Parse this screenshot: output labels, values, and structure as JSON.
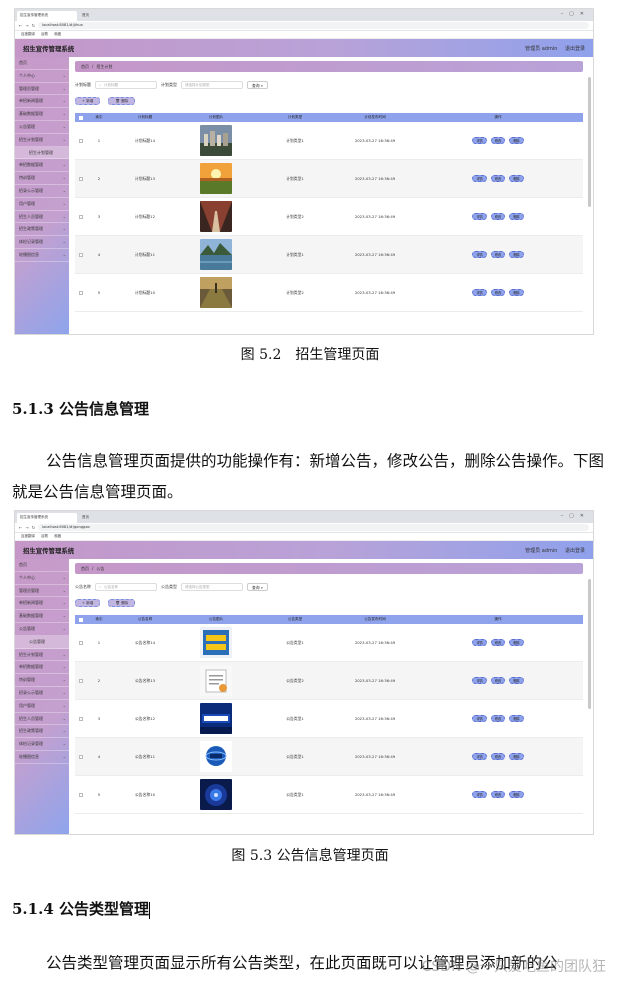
{
  "figures": [
    {
      "tabs": [
        "招生宣传管理系统",
        "首页"
      ],
      "url": "localhost:8081/#/jihua",
      "bookmarks": [
        "百度翻译",
        "谷歌",
        "收藏"
      ],
      "app_title": "招生宣传管理系统",
      "user_info": "管理员 admin",
      "logout": "退出登录",
      "menu": [
        {
          "label": "首页",
          "chev": false,
          "sub": false
        },
        {
          "label": "个人中心",
          "chev": true,
          "sub": false
        },
        {
          "label": "管理员管理",
          "chev": true,
          "sub": false
        },
        {
          "label": "单招新闻管理",
          "chev": true,
          "sub": false
        },
        {
          "label": "基础数据管理",
          "chev": true,
          "sub": false
        },
        {
          "label": "公告管理",
          "chev": true,
          "sub": false
        },
        {
          "label": "招生计划管理",
          "chev": true,
          "sub": false
        },
        {
          "label": "招生计划管理",
          "chev": false,
          "sub": true
        },
        {
          "label": "单招数据管理",
          "chev": true,
          "sub": false
        },
        {
          "label": "特训管理",
          "chev": true,
          "sub": false
        },
        {
          "label": "招录公示管理",
          "chev": true,
          "sub": false
        },
        {
          "label": "用户管理",
          "chev": true,
          "sub": false
        },
        {
          "label": "招生人员管理",
          "chev": true,
          "sub": false
        },
        {
          "label": "招生政策管理",
          "chev": true,
          "sub": false
        },
        {
          "label": "体检记录管理",
          "chev": true,
          "sub": false
        },
        {
          "label": "轮播图信息",
          "chev": true,
          "sub": false
        }
      ],
      "breadcrumb": [
        "首页",
        "招生计划"
      ],
      "search_label1": "计划标题",
      "search_ph1": "计划标题",
      "search_label2": "计划类型",
      "search_ph2": "请选择计划类型",
      "search_btn": "查询",
      "add_btn": "新增",
      "del_btn": "删除",
      "headers": [
        "索引",
        "计划标题",
        "计划图片",
        "计划类型",
        "计划发布时间",
        "操作"
      ],
      "ops": [
        "详情",
        "修改",
        "删除"
      ],
      "rows": [
        {
          "idx": "1",
          "name": "计划标题14",
          "type": "计划类型1",
          "time": "2023-03-27 16:36:49",
          "thumb": "city"
        },
        {
          "idx": "2",
          "name": "计划标题13",
          "type": "计划类型1",
          "time": "2023-03-27 16:36:49",
          "thumb": "sunset"
        },
        {
          "idx": "3",
          "name": "计划标题12",
          "type": "计划类型2",
          "time": "2023-03-27 16:36:49",
          "thumb": "tunnel"
        },
        {
          "idx": "4",
          "name": "计划标题11",
          "type": "计划类型1",
          "time": "2023-03-27 16:36:49",
          "thumb": "lake"
        },
        {
          "idx": "5",
          "name": "计划标题10",
          "type": "计划类型2",
          "time": "2023-03-27 16:36:49",
          "thumb": "field"
        }
      ]
    },
    {
      "tabs": [
        "招生宣传管理系统",
        "首页"
      ],
      "url": "localhost:8081/#/gonggao",
      "bookmarks": [
        "百度翻译",
        "谷歌",
        "收藏"
      ],
      "app_title": "招生宣传管理系统",
      "user_info": "管理员 admin",
      "logout": "退出登录",
      "menu": [
        {
          "label": "首页",
          "chev": false,
          "sub": false
        },
        {
          "label": "个人中心",
          "chev": true,
          "sub": false
        },
        {
          "label": "管理员管理",
          "chev": true,
          "sub": false
        },
        {
          "label": "单招新闻管理",
          "chev": true,
          "sub": false
        },
        {
          "label": "基础数据管理",
          "chev": true,
          "sub": false
        },
        {
          "label": "公告管理",
          "chev": true,
          "sub": false
        },
        {
          "label": "公告管理",
          "chev": false,
          "sub": true
        },
        {
          "label": "招生计划管理",
          "chev": true,
          "sub": false
        },
        {
          "label": "单招数据管理",
          "chev": true,
          "sub": false
        },
        {
          "label": "特训管理",
          "chev": true,
          "sub": false
        },
        {
          "label": "招录公示管理",
          "chev": true,
          "sub": false
        },
        {
          "label": "用户管理",
          "chev": true,
          "sub": false
        },
        {
          "label": "招生人员管理",
          "chev": true,
          "sub": false
        },
        {
          "label": "招生政策管理",
          "chev": true,
          "sub": false
        },
        {
          "label": "体检记录管理",
          "chev": true,
          "sub": false
        },
        {
          "label": "轮播图信息",
          "chev": true,
          "sub": false
        }
      ],
      "breadcrumb": [
        "首页",
        "公告"
      ],
      "search_label1": "公告名称",
      "search_ph1": "公告名称",
      "search_label2": "公告类型",
      "search_ph2": "请选择公告类型",
      "search_btn": "查询",
      "add_btn": "新增",
      "del_btn": "删除",
      "headers": [
        "索引",
        "公告名称",
        "公告图片",
        "公告类型",
        "公告发布时间",
        "操作"
      ],
      "ops": [
        "详情",
        "修改",
        "删除"
      ],
      "rows": [
        {
          "idx": "1",
          "name": "公告名称14",
          "type": "公告类型1",
          "time": "2023-03-27 16:36:49",
          "thumb": "news"
        },
        {
          "idx": "2",
          "name": "公告名称13",
          "type": "公告类型2",
          "time": "2023-03-27 16:36:49",
          "thumb": "doc"
        },
        {
          "idx": "3",
          "name": "公告名称12",
          "type": "公告类型1",
          "time": "2023-03-27 16:36:49",
          "thumb": "shinews"
        },
        {
          "idx": "4",
          "name": "公告名称11",
          "type": "公告类型1",
          "time": "2023-03-27 16:36:49",
          "thumb": "globe"
        },
        {
          "idx": "5",
          "name": "公告名称10",
          "type": "公告类型1",
          "time": "2023-03-27 16:36:49",
          "thumb": "tech"
        }
      ]
    }
  ],
  "doc": {
    "caption1": "图 5.2　招生管理页面",
    "section1": "5.1.3  公告信息管理",
    "para1": "公告信息管理页面提供的功能操作有：新增公告，修改公告，删除公告操作。下图就是公告信息管理页面。",
    "caption2": "图 5.3  公告信息管理页面",
    "section2": "5.1.4 公告类型管理",
    "para2": "公告类型管理页面显示所有公告类型，在此页面既可以让管理员添加新的公",
    "watermark": "CSDN @一只爱吃鱼的团队狂"
  },
  "colors": {
    "header_gradient": [
      "#c597c8",
      "#8fa1ec"
    ],
    "table_header": "#8fa3ec",
    "op_button": "#8fa3ec"
  }
}
